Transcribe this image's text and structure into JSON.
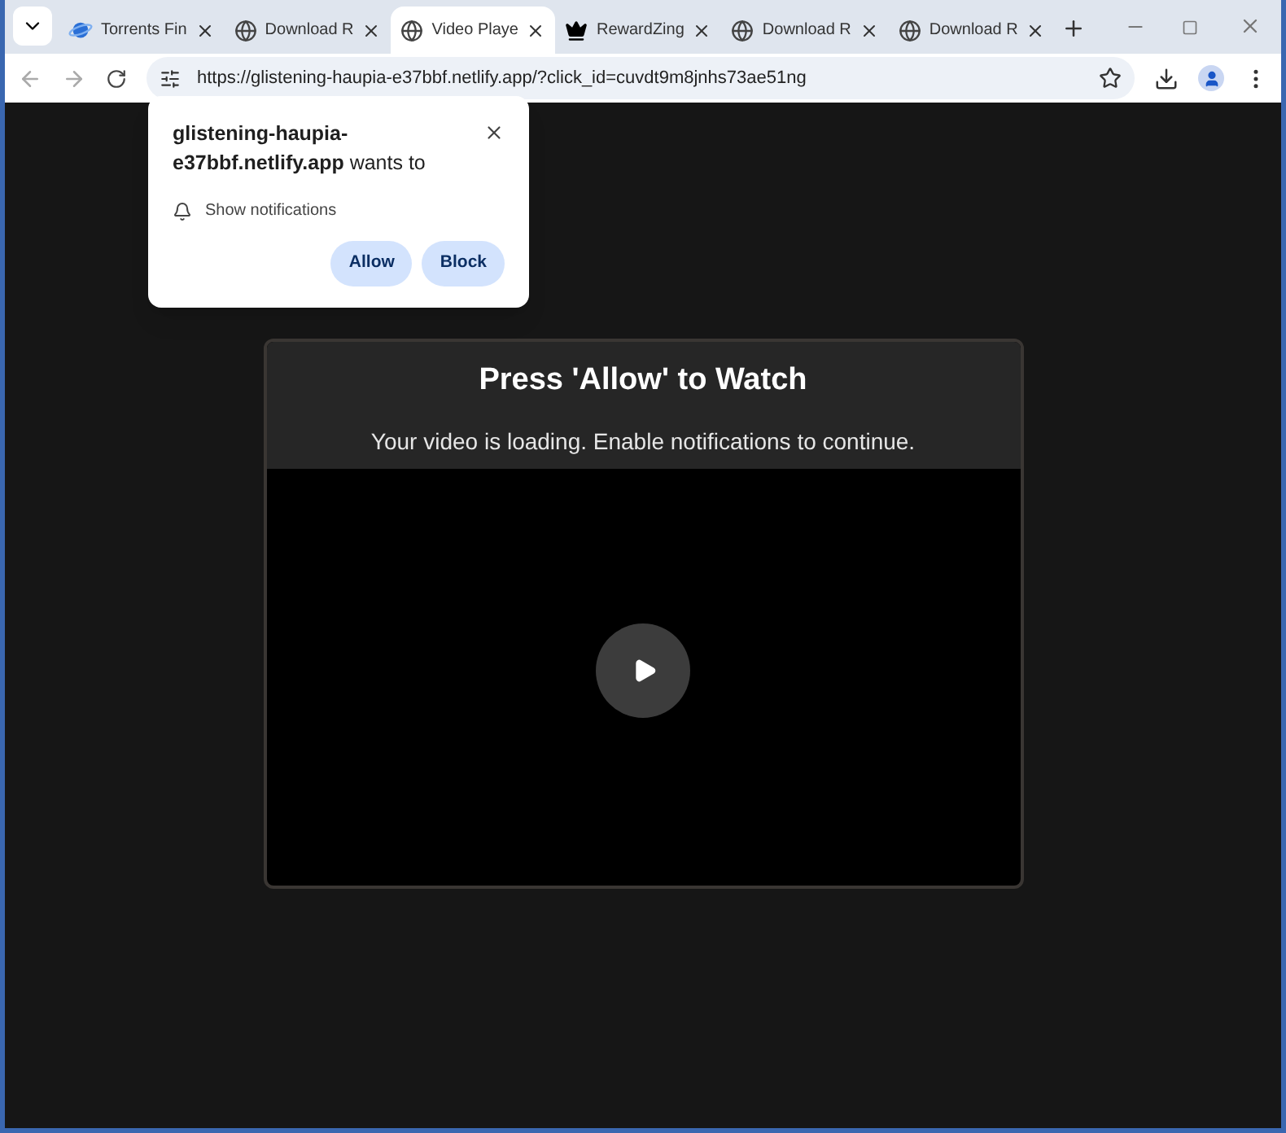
{
  "tabs": [
    {
      "title": "Torrents Fin",
      "kind": "torrent",
      "selected": false
    },
    {
      "title": "Download R",
      "kind": "globe",
      "selected": false
    },
    {
      "title": "Video Playe",
      "kind": "globe",
      "selected": true
    },
    {
      "title": "RewardZing",
      "kind": "crown",
      "selected": false
    },
    {
      "title": "Download R",
      "kind": "globe",
      "selected": false
    },
    {
      "title": "Download R",
      "kind": "globe",
      "selected": false
    }
  ],
  "address_bar": {
    "url": "https://glistening-haupia-e37bbf.netlify.app/?click_id=cuvdt9m8jnhs73ae51ng"
  },
  "permission_popup": {
    "site": "glistening-haupia-e37bbf.netlify.app",
    "suffix": "wants to",
    "permission": "Show notifications",
    "buttons": [
      "Allow",
      "Block"
    ]
  },
  "video_card": {
    "title": "Press 'Allow' to Watch",
    "subtitle": "Your video is loading. Enable notifications to continue."
  }
}
